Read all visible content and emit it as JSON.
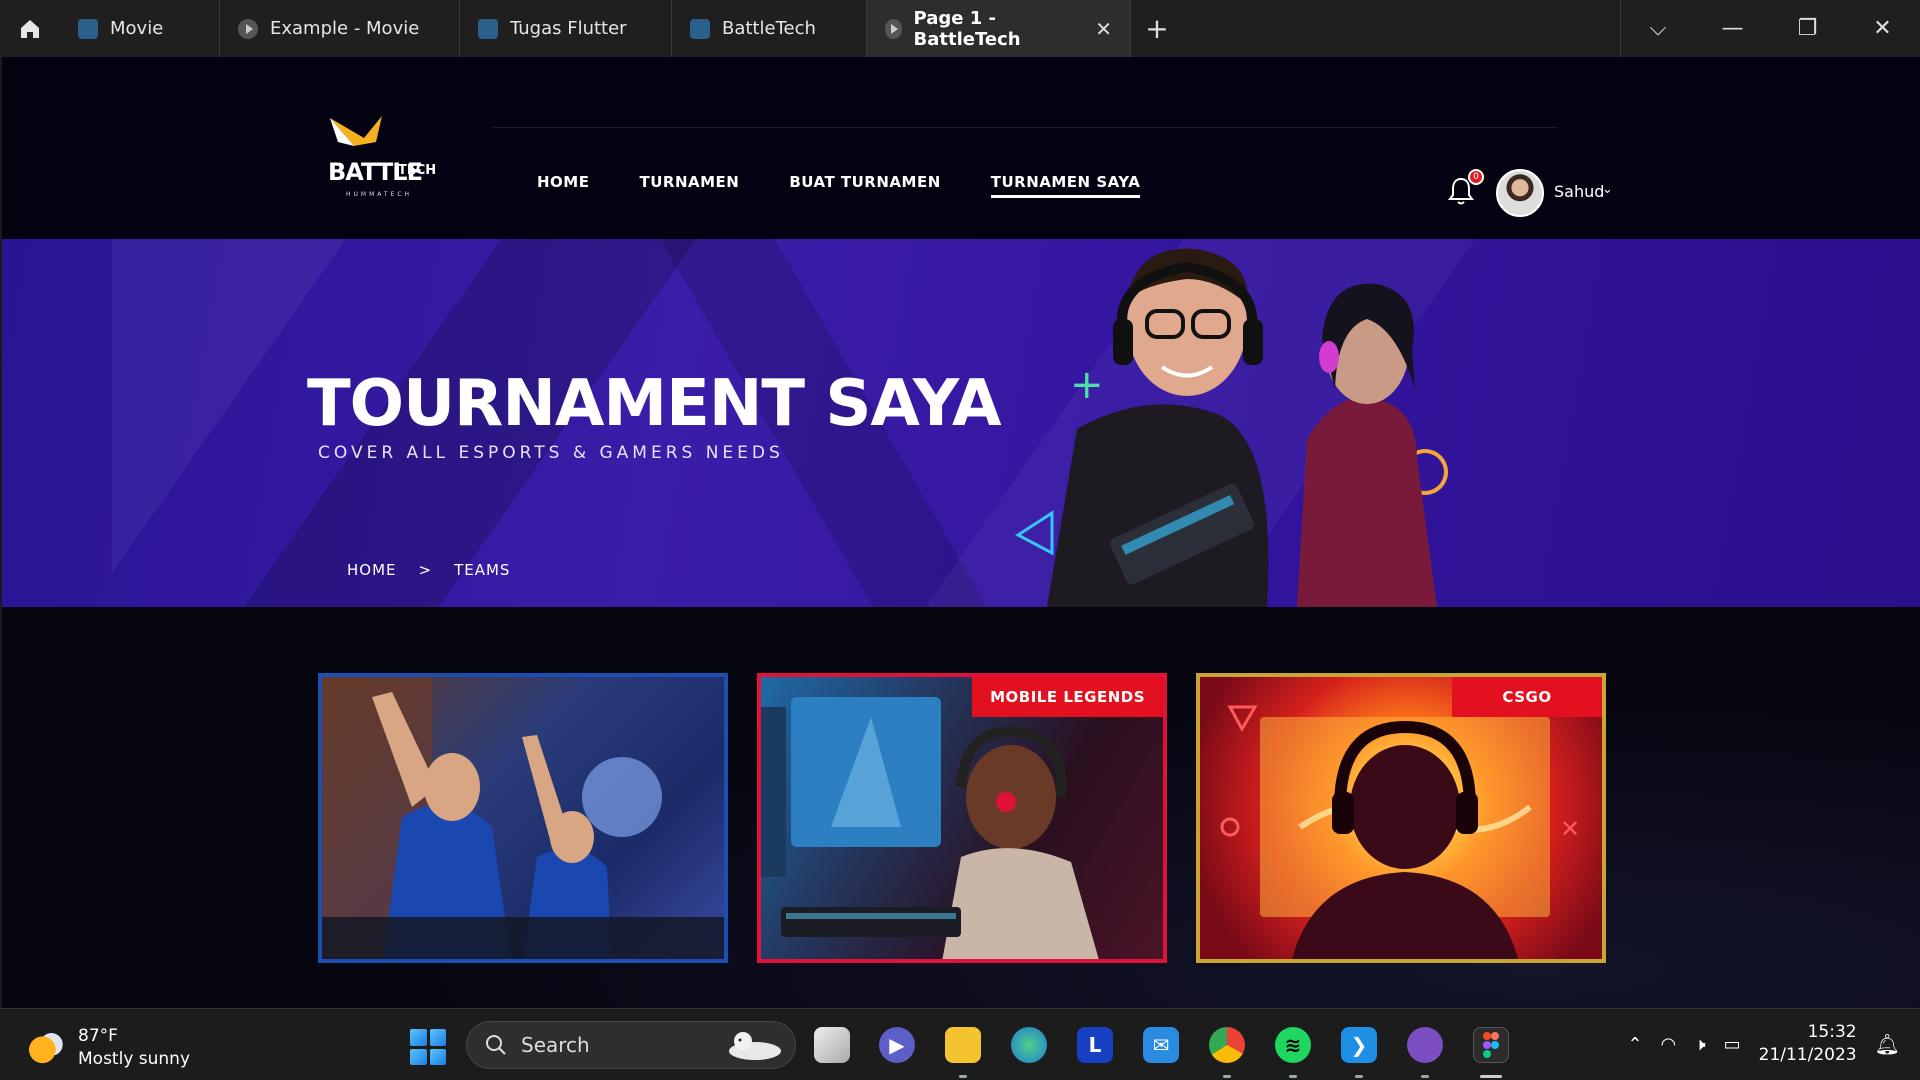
{
  "browser": {
    "tabs": [
      {
        "label": "Movie",
        "icon": "app-icon"
      },
      {
        "label": "Example - Movie",
        "icon": "play-icon"
      },
      {
        "label": "Tugas Flutter",
        "icon": "app-icon"
      },
      {
        "label": "BattleTech",
        "icon": "app-icon"
      },
      {
        "label": "Page 1 - BattleTech",
        "icon": "play-icon",
        "active": true
      }
    ],
    "new_tab": "+"
  },
  "site": {
    "logo": {
      "word1": "BATTLE",
      "word2": "TECH",
      "tagline": "HUMMATECH"
    },
    "nav": [
      {
        "label": "HOME"
      },
      {
        "label": "TURNAMEN"
      },
      {
        "label": "BUAT TURNAMEN"
      },
      {
        "label": "TURNAMEN SAYA",
        "active": true
      }
    ],
    "notifications": {
      "count": "0"
    },
    "user": {
      "name": "Sahud"
    }
  },
  "hero": {
    "title": "TOURNAMENT SAYA",
    "subtitle": "COVER ALL ESPORTS & GAMERS NEEDS",
    "breadcrumb": [
      "HOME",
      ">",
      "TEAMS"
    ]
  },
  "cards": [
    {
      "tag": "",
      "border": "#1c4fb3"
    },
    {
      "tag": "MOBILE LEGENDS",
      "border": "#e0123a"
    },
    {
      "tag": "CSGO",
      "border": "#c9a632"
    }
  ],
  "taskbar": {
    "weather": {
      "temp": "87°F",
      "desc": "Mostly sunny"
    },
    "search_placeholder": "Search",
    "clock": {
      "time": "15:32",
      "date": "21/11/2023"
    }
  },
  "colors": {
    "accent": "#3a1da8",
    "tag": "#e3111f",
    "page_bg": "#040311"
  }
}
